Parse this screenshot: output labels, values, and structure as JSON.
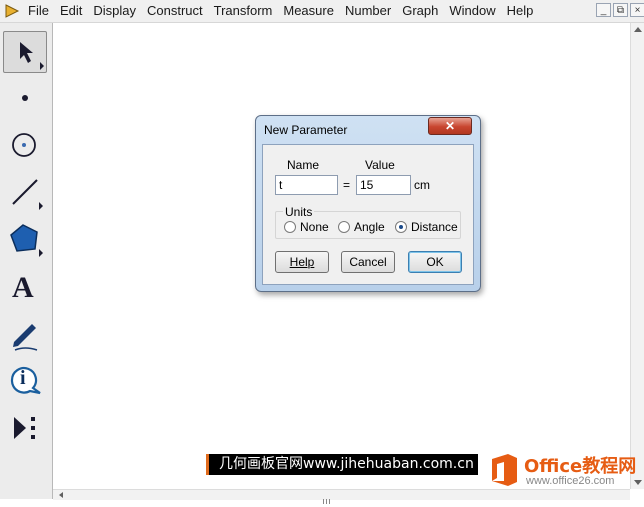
{
  "menu": {
    "items": [
      "File",
      "Edit",
      "Display",
      "Construct",
      "Transform",
      "Measure",
      "Number",
      "Graph",
      "Window",
      "Help"
    ]
  },
  "window_controls": {
    "minimize": "_",
    "restore": "⧉",
    "close": "×"
  },
  "toolbox": {
    "tools": [
      "arrow-select-tool",
      "point-tool",
      "compass-tool",
      "straightedge-tool",
      "polygon-tool",
      "text-tool",
      "marker-tool",
      "information-tool",
      "custom-tool"
    ],
    "text_tool_glyph": "A",
    "info_tool_glyph": "i"
  },
  "dialog": {
    "title": "New Parameter",
    "close_glyph": "✕",
    "name_label": "Name",
    "value_label": "Value",
    "name_value": "t",
    "equals": "=",
    "value_value": "15",
    "unit_text": "cm",
    "units_label": "Units",
    "radios": [
      {
        "label": "None",
        "checked": false
      },
      {
        "label": "Angle",
        "checked": false
      },
      {
        "label": "Distance",
        "checked": true
      }
    ],
    "help_button": "Help",
    "cancel_button": "Cancel",
    "ok_button": "OK"
  },
  "watermarks": {
    "site1": "几何画板官网www.jihehuaban.com.cn",
    "site2_title": "Office教程网",
    "site2_url": "www.office26.com"
  },
  "colors": {
    "dialog_close": "#c8452f",
    "watermark_accent": "#e65c13",
    "radio_selected": "#1a4a8a"
  }
}
